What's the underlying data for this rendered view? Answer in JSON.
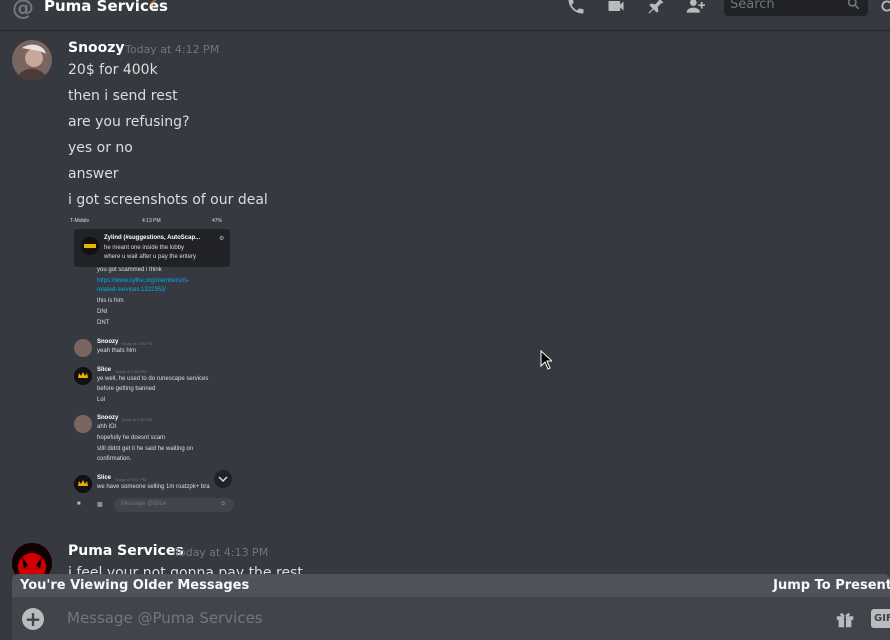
{
  "header": {
    "channel": "Puma Services",
    "status_icon": "moon-icon",
    "search_placeholder": "Search"
  },
  "messages": [
    {
      "author": "Snoozy",
      "time": "Today at 4:12 PM",
      "lines": [
        "20$ for 400k",
        "then i send rest",
        "are you refusing?",
        "yes or no",
        "answer",
        "i got screenshots of our deal"
      ]
    },
    {
      "author": "Puma Services",
      "time": "Today at 4:13 PM",
      "lines": [
        "i feel your not gonna pay the rest"
      ]
    }
  ],
  "attachment": {
    "status_bar": {
      "carrier": "T-Mobile",
      "time": "4:13 PM",
      "battery": "47%"
    },
    "notification": {
      "title": "Zylind (#suggestions, AutoScap...",
      "line1": "he meant one inside the lobby",
      "line2": "where u wait after u pay the entery"
    },
    "lines_top": [
      "you got scammed i think",
      "https://www.sythe.org/members/rs-",
      "related-services.1322353/",
      "this is him",
      "DNt",
      "DNT"
    ],
    "chat": [
      {
        "author": "Snoozy",
        "time": "Today at 3:54 PM",
        "lines": [
          "yeah thats him"
        ]
      },
      {
        "author": "Slice",
        "time": "Today at 3:54 PM",
        "lines": [
          "ye well, he used to do runescape services",
          "before getting banned",
          "Lol"
        ]
      },
      {
        "author": "Snoozy",
        "time": "Today at 3:54 PM",
        "lines": [
          "ahh lOl",
          "hopefully he doesnt scam",
          "still didnt get it he said he waiting on",
          "confirmation."
        ]
      },
      {
        "author": "Slice",
        "time": "Today at 3:57 PM",
        "lines": [
          "we have someone selling 1m roatzpk+ bra"
        ]
      }
    ],
    "composer_placeholder": "Message @Slice"
  },
  "older_bar": {
    "left": "You're Viewing Older Messages",
    "right": "Jump To Present"
  },
  "composer": {
    "placeholder": "Message @Puma Services",
    "gif_label": "GIF"
  },
  "colors": {
    "background": "#36393f",
    "header_text": "#ffffff",
    "muted": "#72767d",
    "link": "#00b0f4",
    "status_idle": "#faa61a"
  }
}
